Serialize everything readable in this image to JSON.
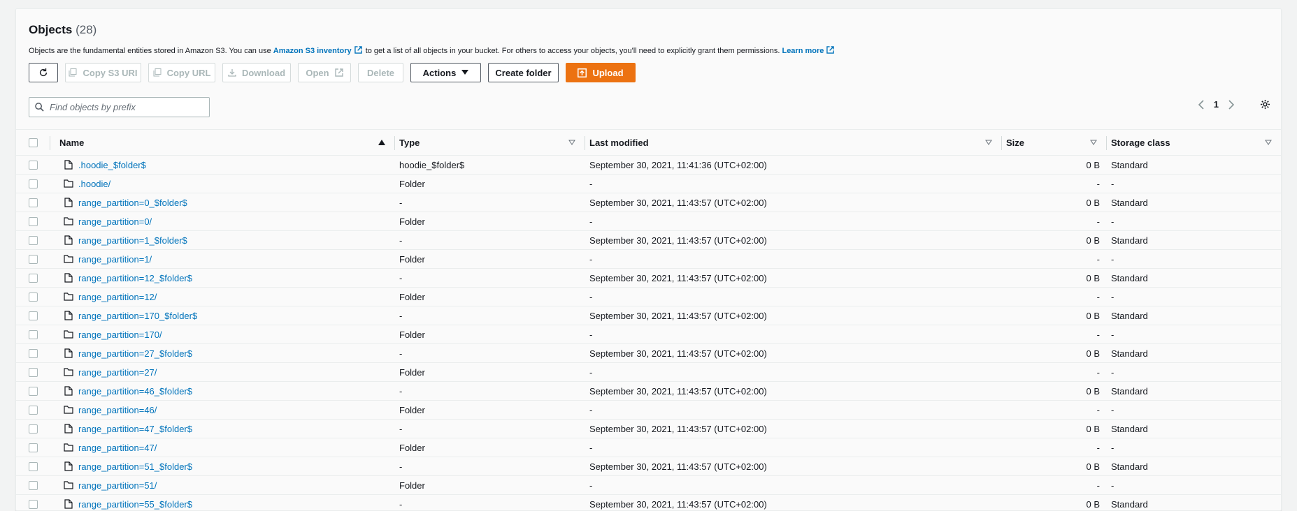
{
  "header": {
    "title": "Objects",
    "count": "(28)",
    "desc_pre": "Objects are the fundamental entities stored in Amazon S3. You can use ",
    "desc_link1": "Amazon S3 inventory",
    "desc_mid": " to get a list of all objects in your bucket. For others to access your objects, you'll need to explicitly grant them permissions. ",
    "desc_link2": "Learn more"
  },
  "toolbar": {
    "copy_s3_uri": "Copy S3 URI",
    "copy_url": "Copy URL",
    "download": "Download",
    "open": "Open",
    "delete": "Delete",
    "actions": "Actions",
    "create_folder": "Create folder",
    "upload": "Upload"
  },
  "search": {
    "placeholder": "Find objects by prefix"
  },
  "pager": {
    "page": "1"
  },
  "columns": {
    "name": "Name",
    "type": "Type",
    "last_modified": "Last modified",
    "size": "Size",
    "storage_class": "Storage class"
  },
  "rows": [
    {
      "icon": "file-icon",
      "name": ".hoodie_$folder$",
      "type": "hoodie_$folder$",
      "modified": "September 30, 2021, 11:41:36 (UTC+02:00)",
      "size": "0 B",
      "class": "Standard"
    },
    {
      "icon": "folder-icon",
      "name": ".hoodie/",
      "type": "Folder",
      "modified": "-",
      "size": "-",
      "class": "-"
    },
    {
      "icon": "file-icon",
      "name": "range_partition=0_$folder$",
      "type": "-",
      "modified": "September 30, 2021, 11:43:57 (UTC+02:00)",
      "size": "0 B",
      "class": "Standard"
    },
    {
      "icon": "folder-icon",
      "name": "range_partition=0/",
      "type": "Folder",
      "modified": "-",
      "size": "-",
      "class": "-"
    },
    {
      "icon": "file-icon",
      "name": "range_partition=1_$folder$",
      "type": "-",
      "modified": "September 30, 2021, 11:43:57 (UTC+02:00)",
      "size": "0 B",
      "class": "Standard"
    },
    {
      "icon": "folder-icon",
      "name": "range_partition=1/",
      "type": "Folder",
      "modified": "-",
      "size": "-",
      "class": "-"
    },
    {
      "icon": "file-icon",
      "name": "range_partition=12_$folder$",
      "type": "-",
      "modified": "September 30, 2021, 11:43:57 (UTC+02:00)",
      "size": "0 B",
      "class": "Standard"
    },
    {
      "icon": "folder-icon",
      "name": "range_partition=12/",
      "type": "Folder",
      "modified": "-",
      "size": "-",
      "class": "-"
    },
    {
      "icon": "file-icon",
      "name": "range_partition=170_$folder$",
      "type": "-",
      "modified": "September 30, 2021, 11:43:57 (UTC+02:00)",
      "size": "0 B",
      "class": "Standard"
    },
    {
      "icon": "folder-icon",
      "name": "range_partition=170/",
      "type": "Folder",
      "modified": "-",
      "size": "-",
      "class": "-"
    },
    {
      "icon": "file-icon",
      "name": "range_partition=27_$folder$",
      "type": "-",
      "modified": "September 30, 2021, 11:43:57 (UTC+02:00)",
      "size": "0 B",
      "class": "Standard"
    },
    {
      "icon": "folder-icon",
      "name": "range_partition=27/",
      "type": "Folder",
      "modified": "-",
      "size": "-",
      "class": "-"
    },
    {
      "icon": "file-icon",
      "name": "range_partition=46_$folder$",
      "type": "-",
      "modified": "September 30, 2021, 11:43:57 (UTC+02:00)",
      "size": "0 B",
      "class": "Standard"
    },
    {
      "icon": "folder-icon",
      "name": "range_partition=46/",
      "type": "Folder",
      "modified": "-",
      "size": "-",
      "class": "-"
    },
    {
      "icon": "file-icon",
      "name": "range_partition=47_$folder$",
      "type": "-",
      "modified": "September 30, 2021, 11:43:57 (UTC+02:00)",
      "size": "0 B",
      "class": "Standard"
    },
    {
      "icon": "folder-icon",
      "name": "range_partition=47/",
      "type": "Folder",
      "modified": "-",
      "size": "-",
      "class": "-"
    },
    {
      "icon": "file-icon",
      "name": "range_partition=51_$folder$",
      "type": "-",
      "modified": "September 30, 2021, 11:43:57 (UTC+02:00)",
      "size": "0 B",
      "class": "Standard"
    },
    {
      "icon": "folder-icon",
      "name": "range_partition=51/",
      "type": "Folder",
      "modified": "-",
      "size": "-",
      "class": "-"
    },
    {
      "icon": "file-icon",
      "name": "range_partition=55_$folder$",
      "type": "-",
      "modified": "September 30, 2021, 11:43:57 (UTC+02:00)",
      "size": "0 B",
      "class": "Standard"
    }
  ],
  "colors": {
    "link": "#0073bb",
    "primary": "#ec7211",
    "border": "#eaeded"
  }
}
